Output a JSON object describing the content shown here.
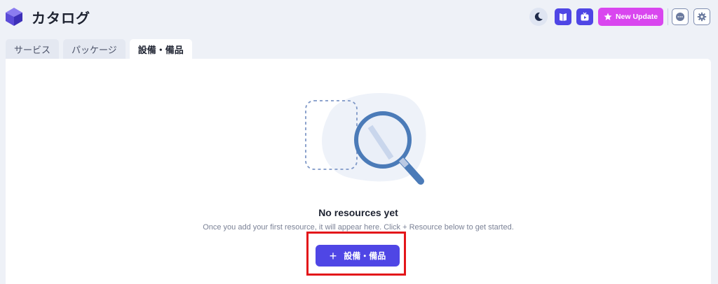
{
  "header": {
    "title": "カタログ",
    "new_update_label": "New Update",
    "icons": [
      "logo-icon",
      "moon-icon",
      "book-icon",
      "tv-icon",
      "star-icon",
      "chat-icon",
      "gear-icon"
    ]
  },
  "tabs": [
    {
      "label": "サービス",
      "active": false
    },
    {
      "label": "パッケージ",
      "active": false
    },
    {
      "label": "設備・備品",
      "active": true
    }
  ],
  "empty_state": {
    "title": "No resources yet",
    "description": "Once you add your first resource, it will appear here. Click + Resource below to get started.",
    "button_label": "設備・備品"
  },
  "colors": {
    "accent": "#4f46e5",
    "update": "#d946ef",
    "highlight": "#e3161a"
  }
}
